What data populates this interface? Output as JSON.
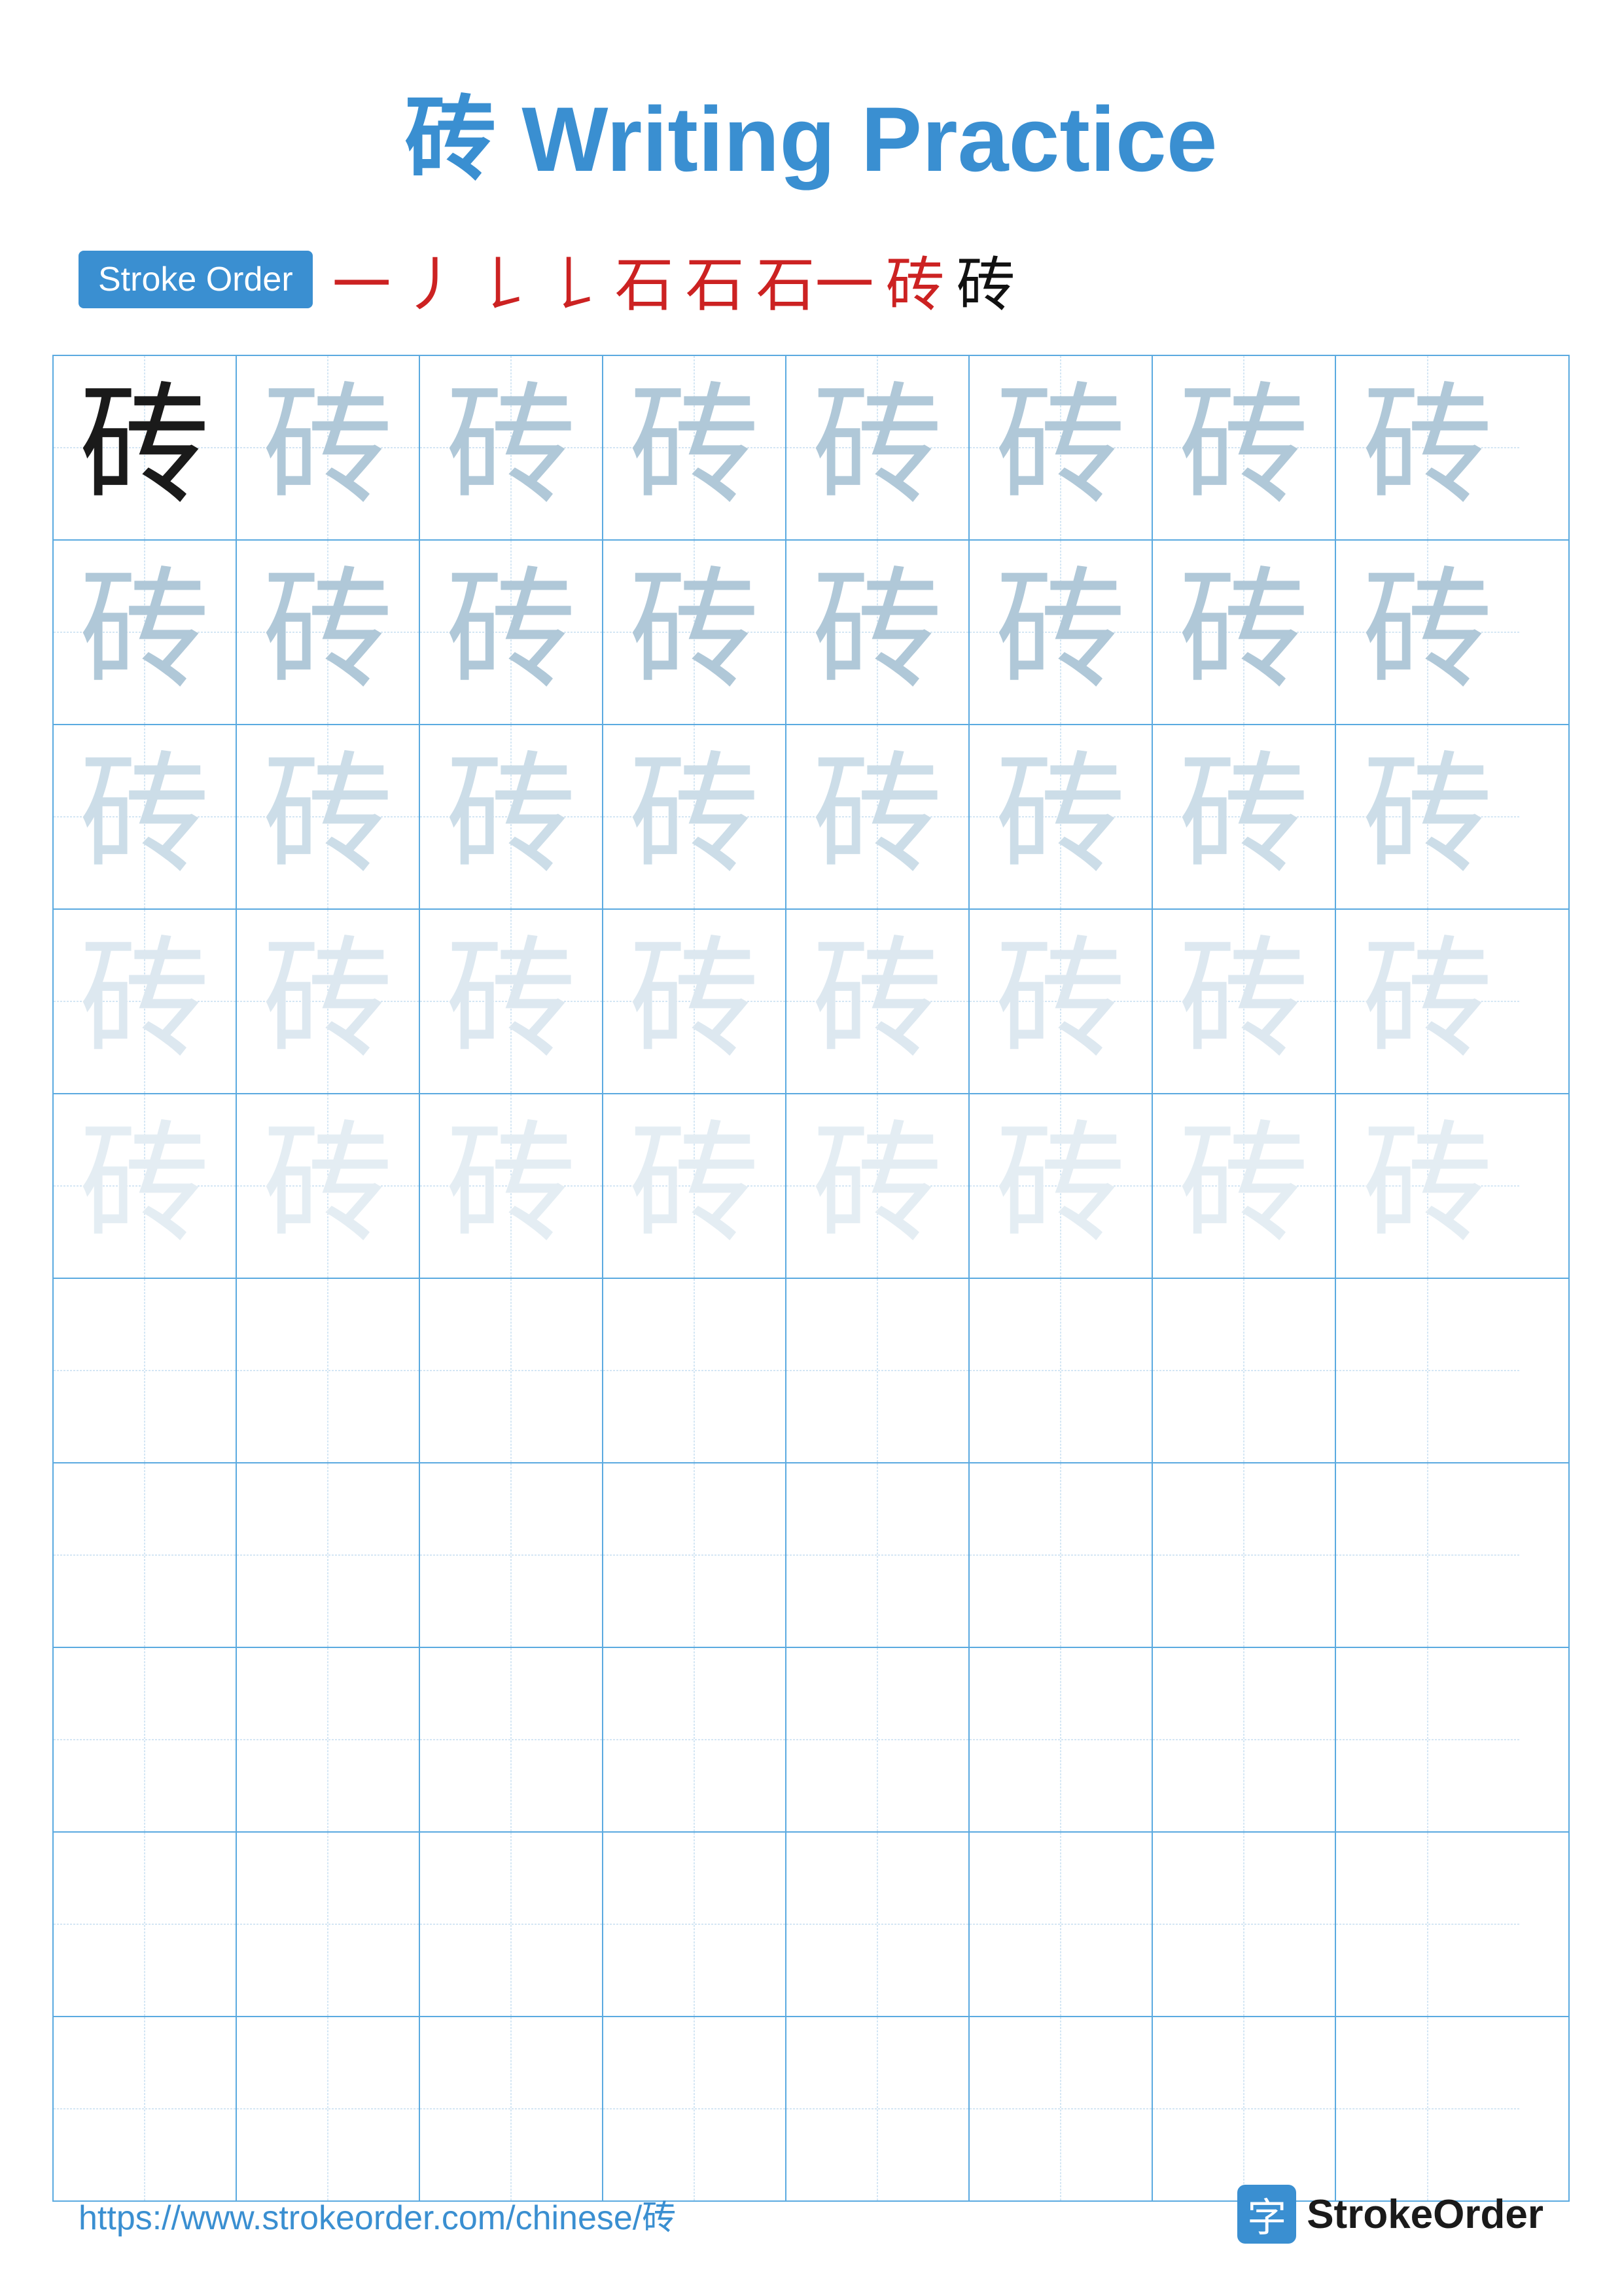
{
  "page": {
    "title_char": "砖",
    "title_text": " Writing Practice",
    "stroke_order_label": "Stroke Order",
    "stroke_sequence": [
      "一",
      "丿",
      "𠄌",
      "𠄌",
      "石",
      "石",
      "石一",
      "砖",
      "砖"
    ],
    "practice_char": "砖",
    "url": "https://www.strokeorder.com/chinese/砖",
    "logo_char": "字",
    "logo_name": "StrokeOrder",
    "grid": {
      "cols": 8,
      "rows": 10,
      "practice_rows": 5,
      "empty_rows": 5
    }
  }
}
